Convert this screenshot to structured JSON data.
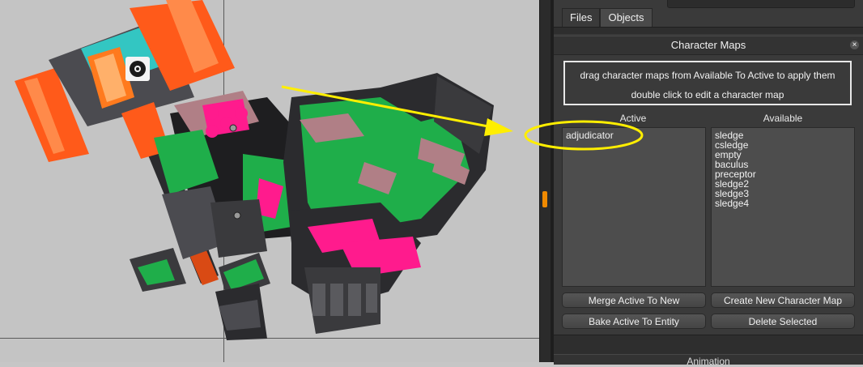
{
  "panel": {
    "top_field_label": "",
    "tabs": [
      {
        "label": "Files"
      },
      {
        "label": "Objects"
      }
    ],
    "character_maps": {
      "title": "Character Maps",
      "close_glyph": "×",
      "hint_line_1": "drag character maps from Available To Active to apply them",
      "hint_line_2": "double click to edit a character map",
      "active_label": "Active",
      "available_label": "Available",
      "active_items": [
        "adjudicator"
      ],
      "available_items": [
        "sledge",
        "csledge",
        "empty",
        "baculus",
        "preceptor",
        "sledge2",
        "sledge3",
        "sledge4"
      ],
      "buttons": {
        "merge": "Merge Active To New",
        "create": "Create New Character Map",
        "bake": "Bake Active To Entity",
        "delete": "Delete Selected"
      }
    },
    "bottom_section_label": "Animation"
  },
  "colors": {
    "splitter_handle": "#f08a00",
    "annotation": "#ffee00",
    "robot_green": "#1fae4a",
    "robot_magenta": "#ff1b8d",
    "robot_orange": "#ff5a1a",
    "robot_teal": "#33c6c2",
    "robot_dark": "#2b2b2e",
    "robot_mauve": "#b07f86"
  },
  "icons": {
    "close": "close-icon",
    "radiation": "radiation-icon",
    "pivot": "pivot-point-icon"
  }
}
